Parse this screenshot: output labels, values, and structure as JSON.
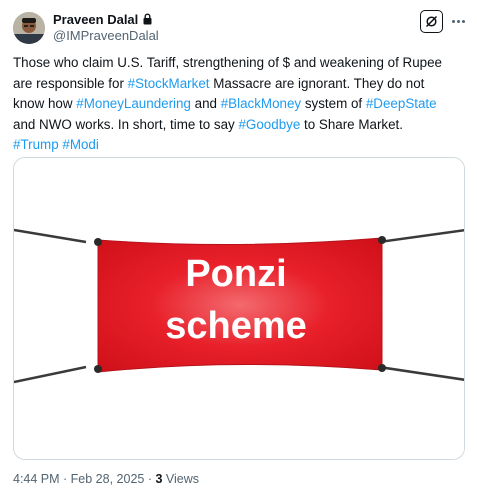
{
  "author": {
    "display_name": "Praveen Dalal",
    "handle": "@IMPraveenDalal",
    "avatar_icon": "profile-photo",
    "protected_icon": "lock-icon"
  },
  "header_actions": {
    "grok_icon": "grok-icon",
    "more_icon": "more-dots-icon"
  },
  "tweet": {
    "line1": "Those who claim U.S. Tariff, strengthening of $ and weakening of Rupee",
    "line2": {
      "before": "are responsible for ",
      "tag1": "#StockMarket",
      "after": " Massacre are ignorant. They do not"
    },
    "line3": {
      "before": "know how ",
      "tag1": "#MoneyLaundering",
      "mid1": " and ",
      "tag2": "#BlackMoney",
      "mid2": " system of ",
      "tag3": "#DeepState"
    },
    "line4": {
      "before": "and NWO works. In short, time to say ",
      "tag1": "#Goodbye",
      "after": " to Share Market."
    },
    "line5": {
      "tag1": "#Trump",
      "space": " ",
      "tag2": "#Modi"
    }
  },
  "media": {
    "banner_line1": "Ponzi",
    "banner_line2": "scheme",
    "banner_color": "#e8202a"
  },
  "meta": {
    "time": "4:44 PM",
    "sep1": " · ",
    "date": "Feb 28, 2025",
    "sep2": " · ",
    "views_count": "3",
    "views_label": " Views"
  },
  "colors": {
    "link": "#1d9bf0",
    "secondary_text": "#536471"
  }
}
